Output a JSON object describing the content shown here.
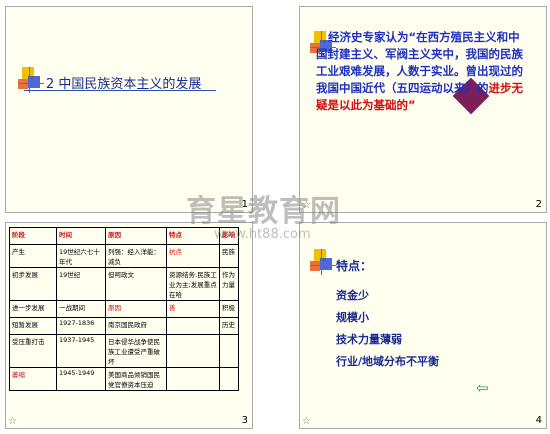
{
  "slides": [
    {
      "number": "1",
      "title": "2 中国民族资本主义的发展"
    },
    {
      "number": "2",
      "quote_blue": "经济史专家认为“在西方殖民主义和中国封建主义、军阀主义夹中，我国的民族工业艰难发展，人数于实业。曾出现过的我国中国近代（五四运动以来）的",
      "quote_red": "进步无疑是以此为基础的”"
    },
    {
      "number": "3",
      "table": {
        "headers": [
          "阶段",
          "时间",
          "原因",
          "特点",
          "影响"
        ],
        "rows": [
          [
            "产生",
            "19世纪六七十年代",
            "列强：经入洋能：减负",
            "抗点",
            "民族"
          ],
          [
            "初步发展",
            "19世纪",
            "但呵政文",
            "资源结务:民族工业为主;发展重点在哈",
            "作为力量"
          ],
          [
            "进一步发展",
            "一战期间",
            "原因",
            "善",
            "积极"
          ],
          [
            "短暂发展",
            "1927-1836",
            "南京国民政府",
            "",
            "历史"
          ],
          [
            "受压重打击",
            "1937-1945",
            "日本侵华战争使民族工业遭受严重破坏",
            "",
            ""
          ],
          [
            "萎缩",
            "1945-1949",
            "美国商品倾销国民党官僚资本压迫",
            "",
            ""
          ]
        ]
      }
    },
    {
      "number": "4",
      "heading": "特点：",
      "items": [
        "资金少",
        "规模小",
        "技术力量薄弱",
        "行业/地域分布不平衡"
      ]
    }
  ],
  "watermark": {
    "main": "育星教育网",
    "sub": "www.ht88.com"
  },
  "colors": {
    "background": "#fffff0",
    "title_blue": "#1a2b8f",
    "accent_red": "#d01010"
  }
}
